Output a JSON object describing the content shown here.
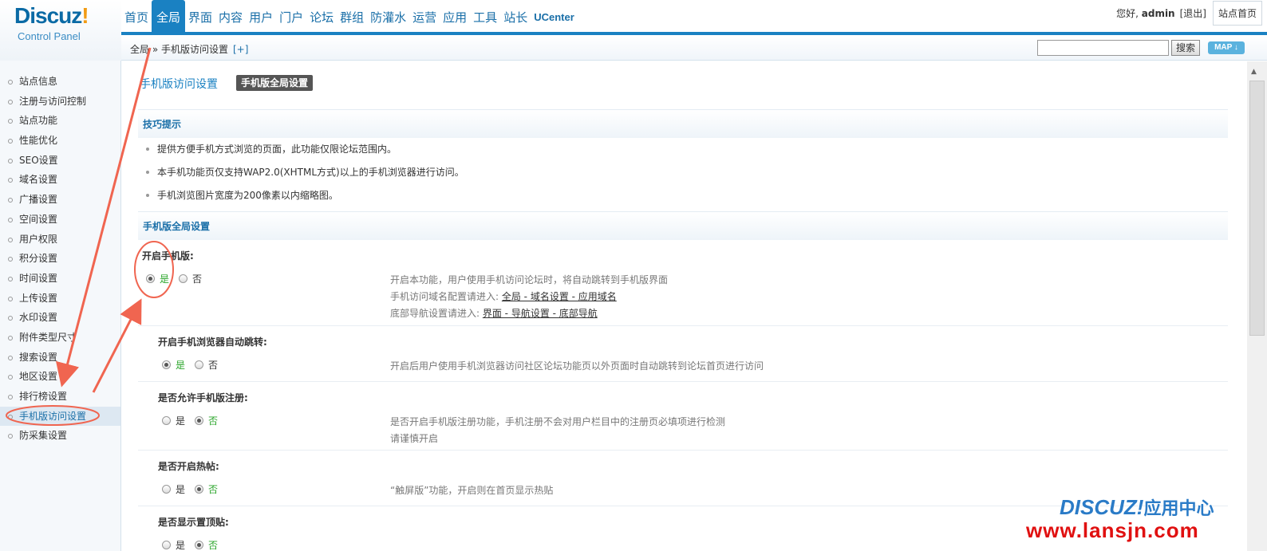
{
  "logo": {
    "brand": "Discuz",
    "exclaim": "!",
    "subtitle": "Control Panel"
  },
  "topnav": [
    {
      "label": "首页",
      "active": false
    },
    {
      "label": "全局",
      "active": true
    },
    {
      "label": "界面",
      "active": false
    },
    {
      "label": "内容",
      "active": false
    },
    {
      "label": "用户",
      "active": false
    },
    {
      "label": "门户",
      "active": false
    },
    {
      "label": "论坛",
      "active": false
    },
    {
      "label": "群组",
      "active": false
    },
    {
      "label": "防灌水",
      "active": false
    },
    {
      "label": "运营",
      "active": false
    },
    {
      "label": "应用",
      "active": false
    },
    {
      "label": "工具",
      "active": false
    },
    {
      "label": "站长",
      "active": false
    },
    {
      "label": "UCenter",
      "active": false
    }
  ],
  "user": {
    "greeting": "您好, ",
    "name": "admin",
    "logout": "[退出]",
    "site_home": "站点首页"
  },
  "breadcrumb": {
    "path": "全局 » 手机版访问设置",
    "plus": "[+]",
    "search_button": "搜索",
    "map_button": "MAP ↓"
  },
  "sidebar": {
    "items": [
      "站点信息",
      "注册与访问控制",
      "站点功能",
      "性能优化",
      "SEO设置",
      "域名设置",
      "广播设置",
      "空间设置",
      "用户权限",
      "积分设置",
      "时间设置",
      "上传设置",
      "水印设置",
      "附件类型尺寸",
      "搜索设置",
      "地区设置",
      "排行榜设置",
      "手机版访问设置",
      "防采集设置"
    ],
    "active_index": 17
  },
  "main": {
    "title": "手机版访问设置",
    "tab": "手机版全局设置",
    "tips_header": "技巧提示",
    "tips": [
      "提供方便手机方式浏览的页面，此功能仅限论坛范围内。",
      "本手机功能页仅支持WAP2.0(XHTML方式)以上的手机浏览器进行访问。",
      "手机浏览图片宽度为200像素以内缩略图。"
    ],
    "global_header": "手机版全局设置",
    "yes": "是",
    "no": "否",
    "settings": [
      {
        "label": "开启手机版:",
        "selected": "yes",
        "desc1": "开启本功能，用户使用手机访问论坛时，将自动跳转到手机版界面",
        "desc2_prefix": "手机访问域名配置请进入: ",
        "desc2_link": "全局 - 域名设置 - 应用域名",
        "desc3_prefix": "底部导航设置请进入: ",
        "desc3_link": "界面 - 导航设置 - 底部导航"
      },
      {
        "label": "开启手机浏览器自动跳转:",
        "selected": "yes",
        "desc1": "开启后用户使用手机浏览器访问社区论坛功能页以外页面时自动跳转到论坛首页进行访问"
      },
      {
        "label": "是否允许手机版注册:",
        "selected": "no",
        "desc1": "是否开启手机版注册功能，手机注册不会对用户栏目中的注册页必填项进行检测",
        "desc2": "请谨慎开启"
      },
      {
        "label": "是否开启热帖:",
        "selected": "no",
        "desc1": "“触屏版”功能，开启则在首页显示热贴"
      },
      {
        "label": "是否显示置顶贴:",
        "selected": "no"
      }
    ]
  },
  "watermark": {
    "line1": "DISCUZ!",
    "line1_cn": "应用中心",
    "line2": "www.lansjn.com"
  }
}
